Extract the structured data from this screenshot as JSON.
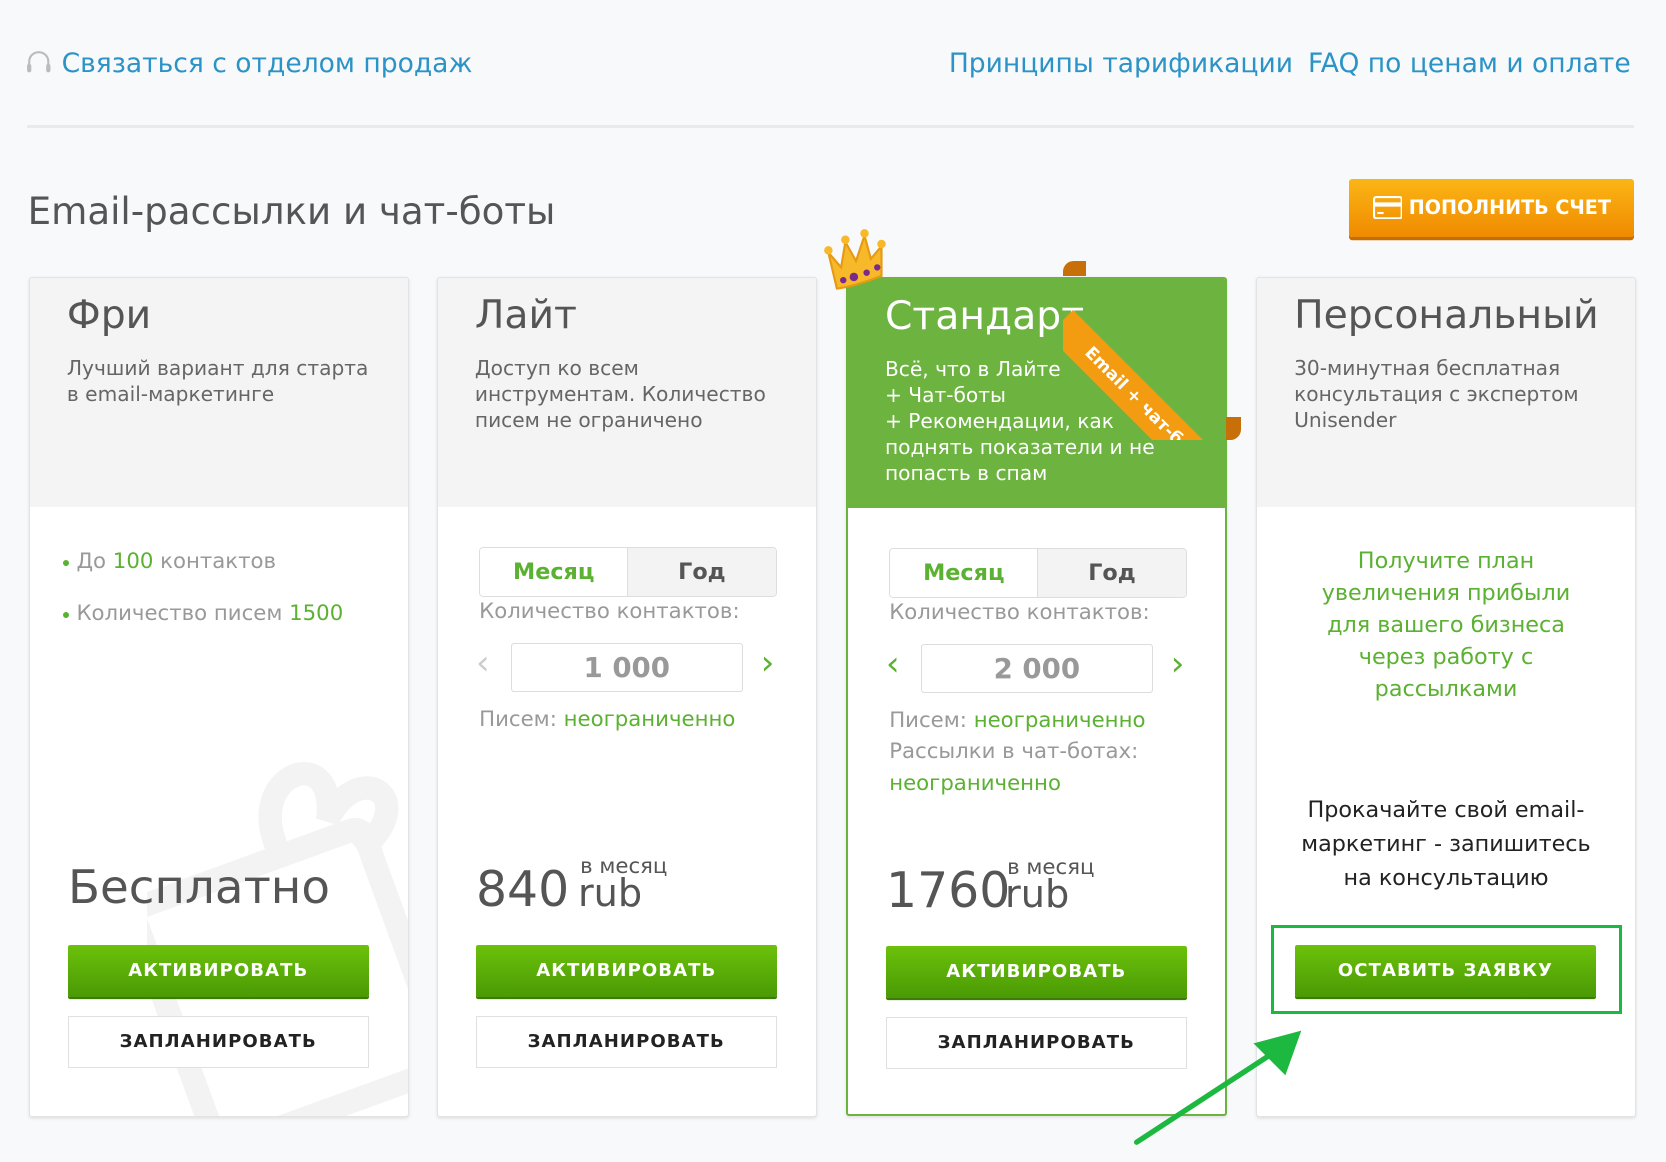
{
  "nav": {
    "contact_sales": "Связаться с отделом продаж",
    "pricing_principles": "Принципы тарификации",
    "faq": "FAQ по ценам и оплате"
  },
  "page_title": "Email-рассылки и чат-боты",
  "topup_button": "ПОПОЛНИТЬ СЧЕТ",
  "accent_green": "#6cb33f",
  "accent_orange": "#f39c12",
  "plans": [
    {
      "name": "Фри",
      "desc": "Лучший вариант для старта в email-маркетинге",
      "bullets": [
        {
          "pre": "До ",
          "val": "100",
          "post": " контактов"
        },
        {
          "pre": "Количество писем ",
          "val": "1500",
          "post": ""
        }
      ],
      "price": "Бесплатно",
      "activate": "АКТИВИРОВАТЬ",
      "schedule": "ЗАПЛАНИРОВАТЬ"
    },
    {
      "name": "Лайт",
      "desc": "Доступ ко всем инструментам. Количество писем не ограничено",
      "period_month": "Месяц",
      "period_year": "Год",
      "contacts_label": "Количество контактов:",
      "contacts": "1 000",
      "letters_label": "Писем:",
      "letters_value": "неограниченно",
      "price": "840",
      "price_unit": "rub",
      "price_period": "в месяц",
      "activate": "АКТИВИРОВАТЬ",
      "schedule": "ЗАПЛАНИРОВАТЬ"
    },
    {
      "name": "Стандарт",
      "desc_lines": [
        "Всё, что в Лайте",
        "+ Чат-боты",
        "+ Рекомендации, как поднять показатели и не попасть в спам"
      ],
      "ribbon": "Email + чат-боты",
      "period_month": "Месяц",
      "period_year": "Год",
      "contacts_label": "Количество контактов:",
      "contacts": "2 000",
      "letters_label": "Писем:",
      "letters_value": "неограниченно",
      "chatbot_label": "Рассылки в чат-ботах:",
      "chatbot_value": "неограниченно",
      "price": "1760",
      "price_unit": "rub",
      "price_period": "в месяц",
      "activate": "АКТИВИРОВАТЬ",
      "schedule": "ЗАПЛАНИРОВАТЬ"
    },
    {
      "name": "Персональный",
      "desc": "30-минутная бесплатная консультация с экспертом Unisender",
      "offer": "Получите план увеличения прибыли для вашего бизнеса через работу с рассылками",
      "cta_text": "Прокачайте свой email-маркетинг - запишитесь на консультацию",
      "request": "ОСТАВИТЬ ЗАЯВКУ"
    }
  ]
}
